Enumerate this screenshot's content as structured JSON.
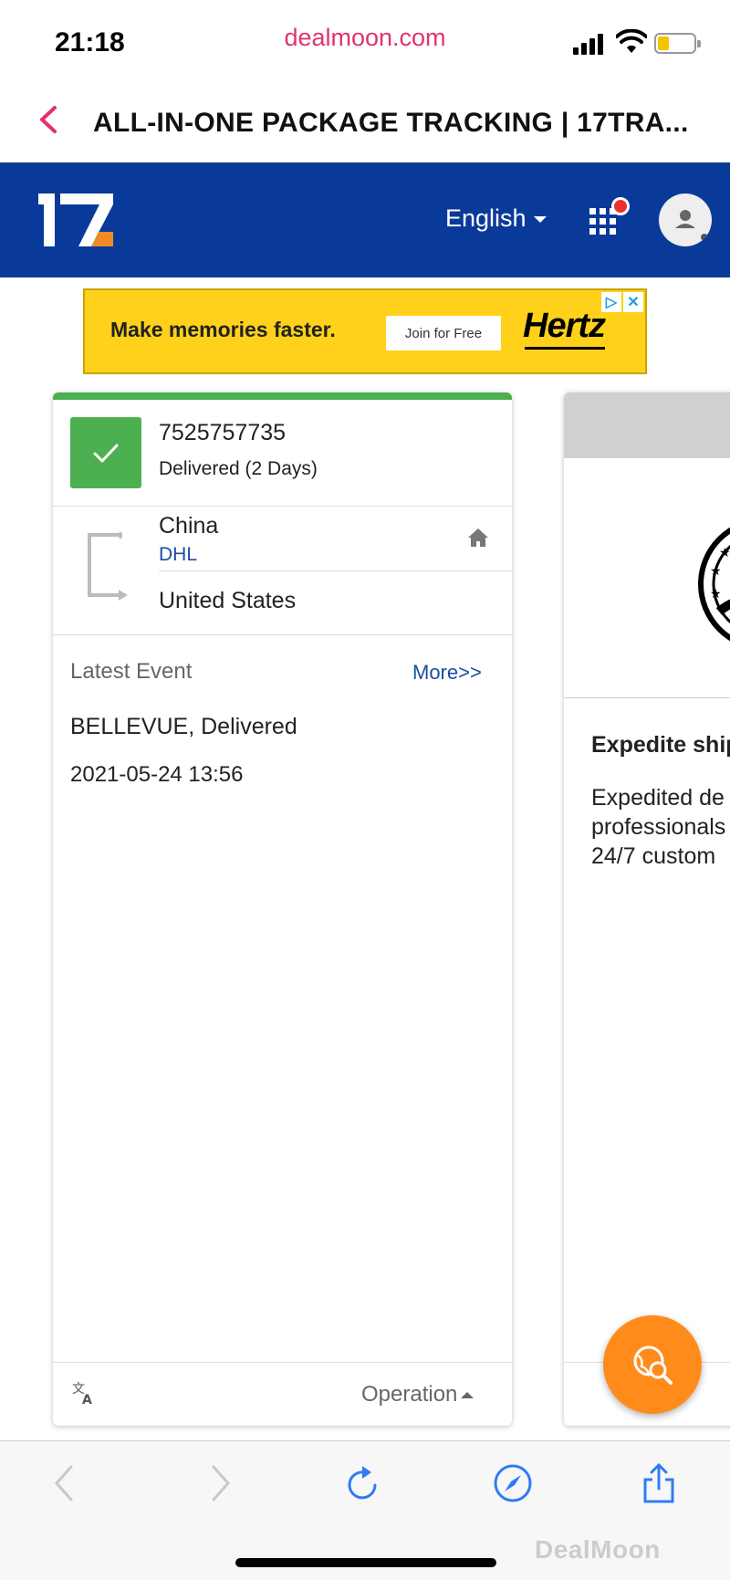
{
  "status_bar": {
    "time": "21:18",
    "site": "dealmoon.com"
  },
  "nav": {
    "title": "ALL-IN-ONE PACKAGE TRACKING | 17TRA..."
  },
  "header": {
    "logo_text": "17",
    "language": "English"
  },
  "ad": {
    "headline": "Make memories faster.",
    "cta": "Join for Free",
    "brand": "Hertz",
    "choices_icon": "▷",
    "close_icon": "✕"
  },
  "tracking": {
    "number": "7525757735",
    "status": "Delivered (2 Days)",
    "origin": "China",
    "carrier": "DHL",
    "destination": "United States",
    "latest_event_label": "Latest Event",
    "more_link": "More>>",
    "event": "BELLEVUE, Delivered",
    "event_time": "2021-05-24 13:56",
    "operation_label": "Operation"
  },
  "side_card": {
    "heading": "Expedite ship",
    "body_lines": [
      "Expedited de",
      "professionals",
      "24/7 custom"
    ]
  },
  "watermark": "DealMoon",
  "colors": {
    "header_blue": "#0a3a99",
    "delivered_green": "#4caf50",
    "fab_orange": "#ff8c1a",
    "link_blue": "#1a4da3"
  }
}
